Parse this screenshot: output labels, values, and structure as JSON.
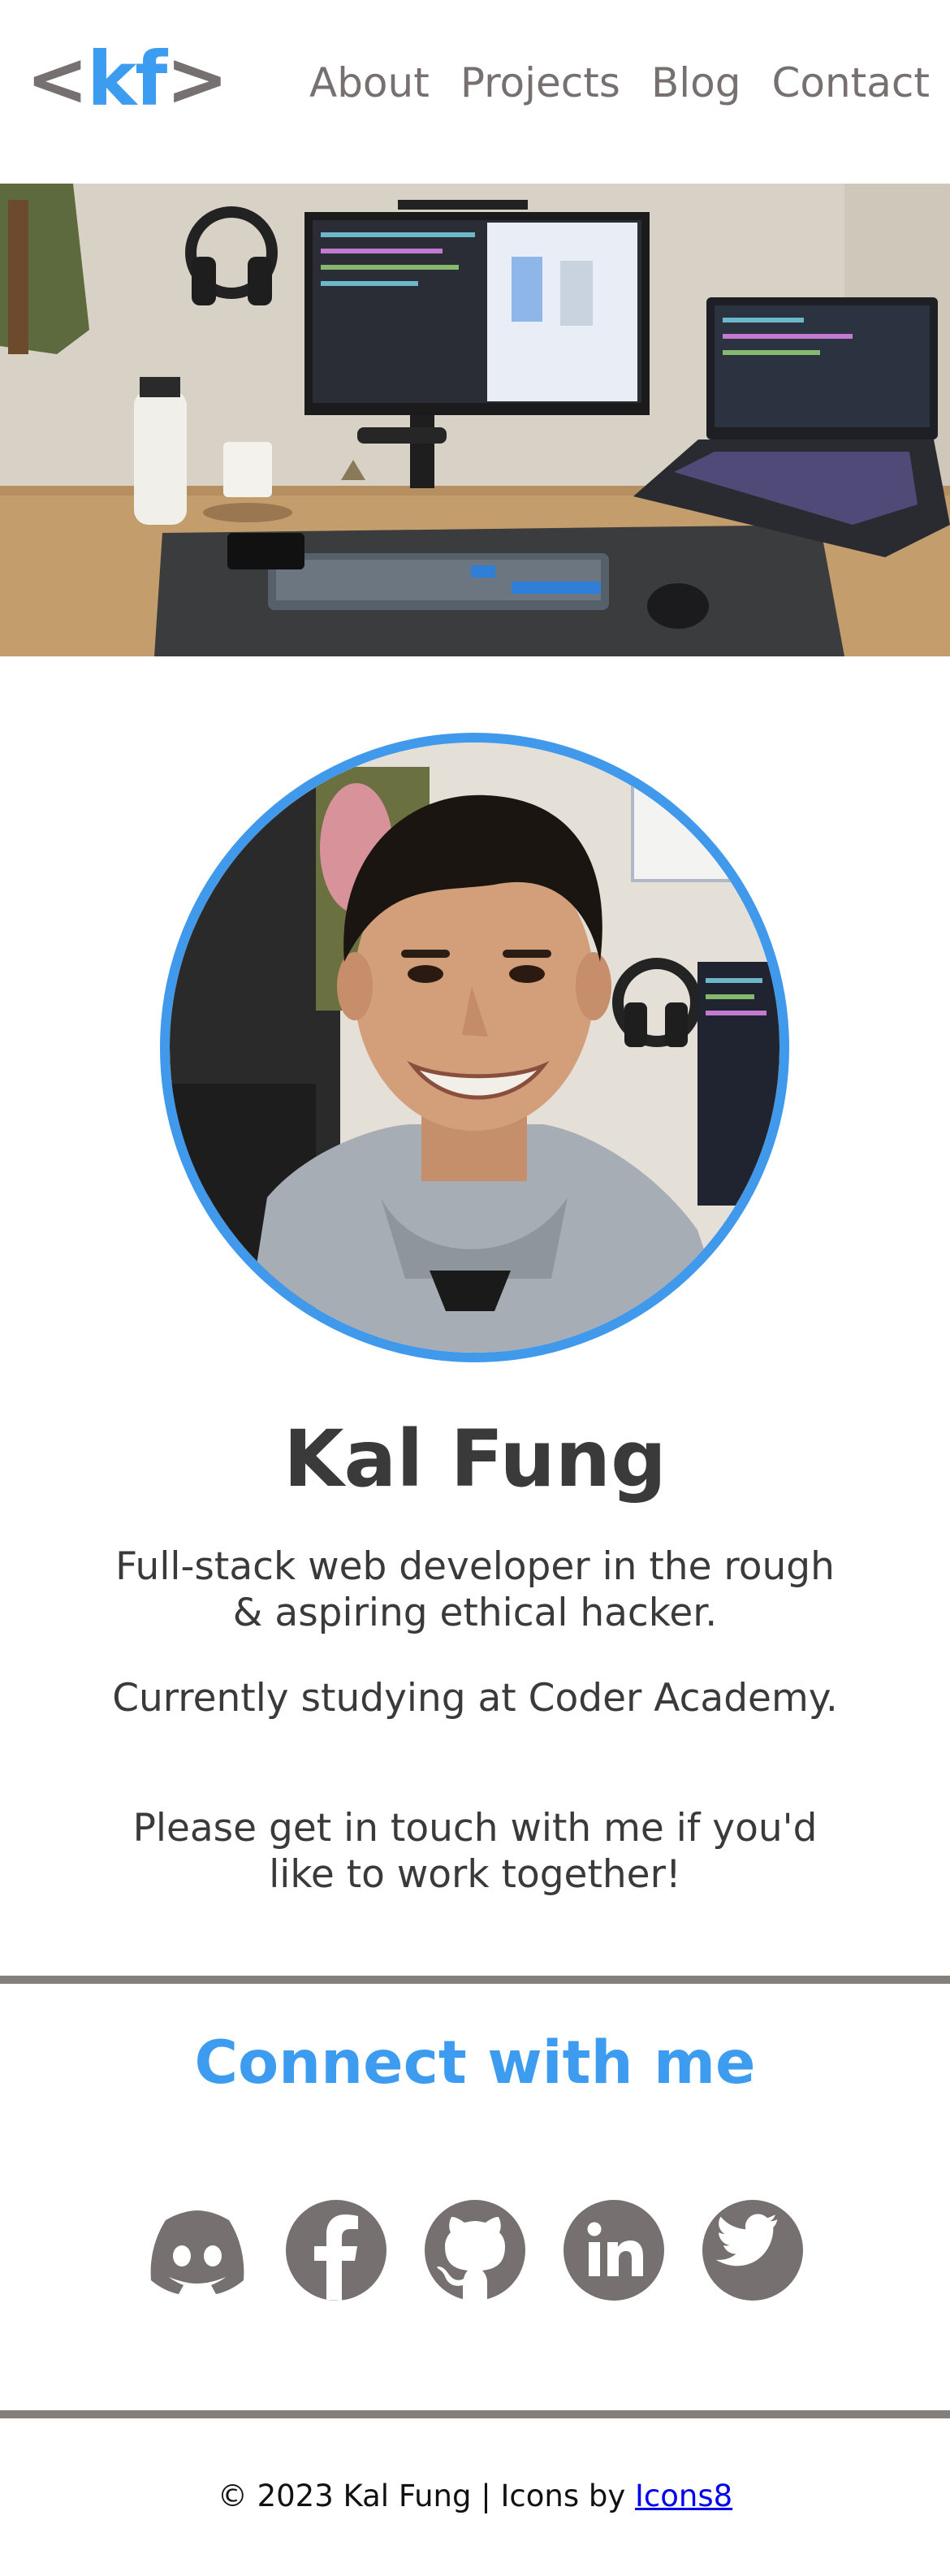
{
  "header": {
    "logo": {
      "open": "<",
      "text": "kf",
      "close": ">"
    },
    "nav": [
      {
        "label": "About"
      },
      {
        "label": "Projects"
      },
      {
        "label": "Blog"
      },
      {
        "label": "Contact"
      }
    ]
  },
  "hero": {
    "image": "desk-setup-photo"
  },
  "profile": {
    "image": "profile-photo",
    "name": "Kal Fung",
    "bio": [
      "Full-stack web developer in the rough & aspiring ethical hacker.",
      "Currently studying at Coder Academy.",
      "Please get in touch with me if you'd like to work together!"
    ]
  },
  "connect": {
    "title": "Connect with me",
    "icons": [
      "discord-icon",
      "facebook-icon",
      "github-icon",
      "linkedin-icon",
      "twitter-icon"
    ]
  },
  "footer": {
    "text": "© 2023 Kal Fung | Icons by ",
    "link": "Icons8"
  },
  "colors": {
    "accent": "#3b9cf0",
    "grey": "#767170",
    "rule": "#857f7b"
  }
}
